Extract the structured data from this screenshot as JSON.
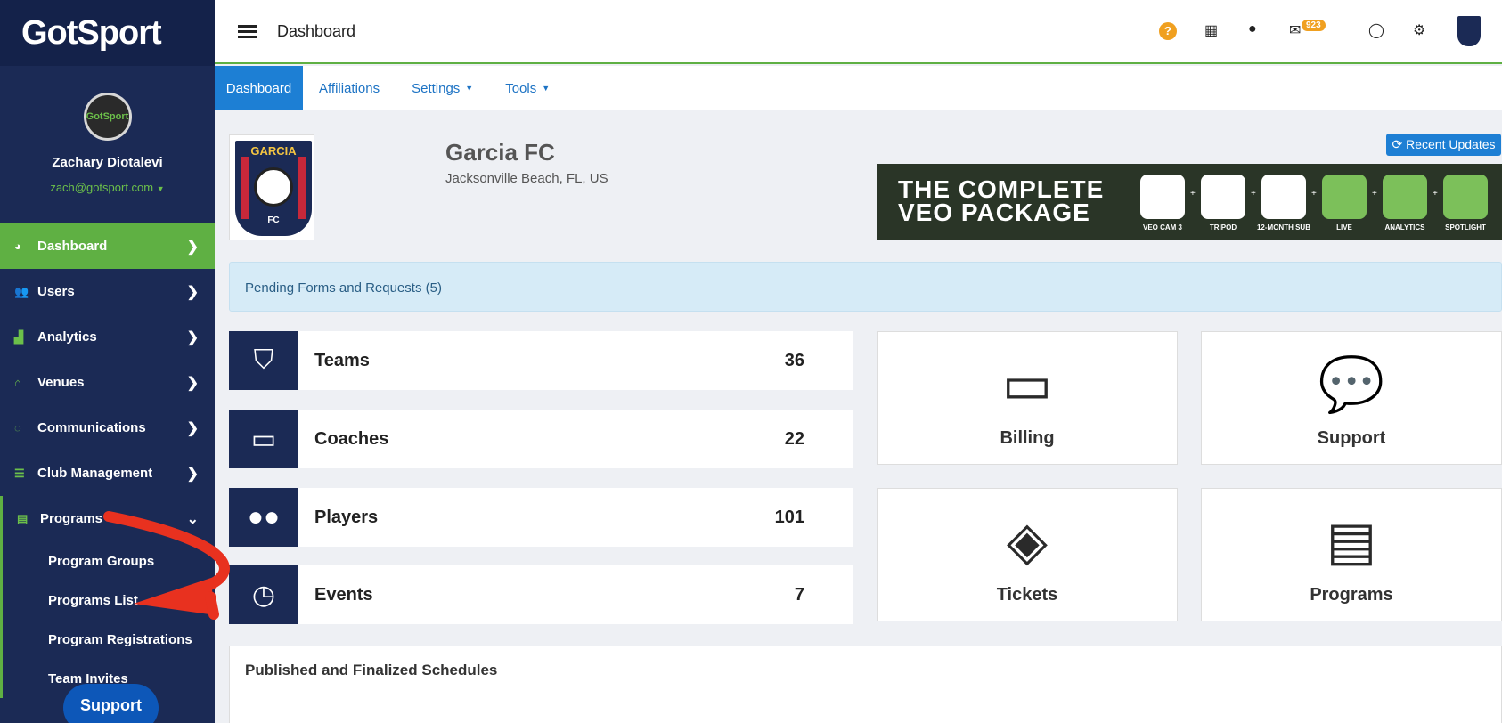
{
  "brand": {
    "logo": "GotSport"
  },
  "user": {
    "avatar_text": "GotSport",
    "name": "Zachary Diotalevi",
    "email": "zach@gotsport.com"
  },
  "sidebar": {
    "items": [
      {
        "label": "Dashboard",
        "icon": "dashboard-icon"
      },
      {
        "label": "Users",
        "icon": "users-icon"
      },
      {
        "label": "Analytics",
        "icon": "analytics-icon"
      },
      {
        "label": "Venues",
        "icon": "venues-icon"
      },
      {
        "label": "Communications",
        "icon": "communications-icon"
      },
      {
        "label": "Club Management",
        "icon": "club-management-icon"
      },
      {
        "label": "Programs",
        "icon": "programs-icon"
      }
    ],
    "sub_items": [
      "Program Groups",
      "Programs List",
      "Program Registrations",
      "Team Invites"
    ],
    "support_label": "Support"
  },
  "topbar": {
    "title": "Dashboard",
    "help": "?",
    "mail_count": "923"
  },
  "subnav": {
    "tabs": [
      "Dashboard",
      "Affiliations",
      "Settings",
      "Tools"
    ]
  },
  "club": {
    "name": "Garcia FC",
    "location": "Jacksonville Beach, FL, US",
    "crest_text": "GARCIA",
    "crest_fc": "FC"
  },
  "recent_updates": "Recent Updates",
  "banner": {
    "line1": "THE COMPLETE",
    "line2": "VEO PACKAGE",
    "items": [
      "VEO CAM 3",
      "TRIPOD",
      "12-MONTH SUB",
      "LIVE",
      "ANALYTICS",
      "SPOTLIGHT"
    ]
  },
  "pending": "Pending Forms and Requests (5)",
  "stats": [
    {
      "label": "Teams",
      "value": "36"
    },
    {
      "label": "Coaches",
      "value": "22"
    },
    {
      "label": "Players",
      "value": "101"
    },
    {
      "label": "Events",
      "value": "7"
    }
  ],
  "tiles": [
    "Billing",
    "Support",
    "Tickets",
    "Programs"
  ],
  "schedules": {
    "title": "Published and Finalized Schedules"
  },
  "colors": {
    "navy": "#1b2a55",
    "green": "#5fb043",
    "blue": "#1d7fd4",
    "annotation_red": "#e8311f"
  }
}
